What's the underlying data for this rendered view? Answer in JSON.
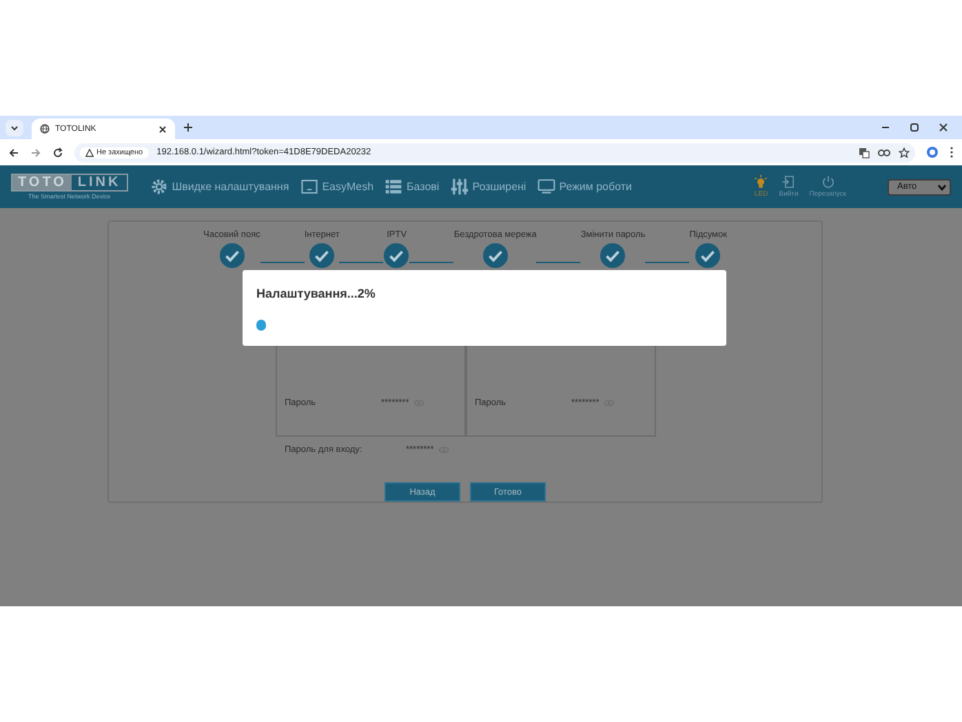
{
  "browser": {
    "tab": {
      "title": "TOTOLINK"
    },
    "security": "Не захищено",
    "url": "192.168.0.1/wizard.html?token=41D8E79DEDA20232"
  },
  "header": {
    "logo": "TOTO",
    "logo_box": "LINK",
    "tagline": "The Smartest Network Device",
    "nav": [
      {
        "kind": "gear",
        "label": "Швидке налаштування"
      },
      {
        "kind": "mesh",
        "label": "EasyMesh"
      },
      {
        "kind": "list",
        "label": "Базові"
      },
      {
        "kind": "sliders",
        "label": "Розширені"
      },
      {
        "kind": "monitor",
        "label": "Режим роботи"
      }
    ],
    "actions": [
      {
        "kind": "led",
        "label": "LED"
      },
      {
        "kind": "logout",
        "label": "Вийти"
      },
      {
        "kind": "power",
        "label": "Перезапуск"
      }
    ],
    "language": "Авто"
  },
  "steps": [
    {
      "label": "Часовий пояс",
      "done": true
    },
    {
      "label": "Інтернет",
      "done": true
    },
    {
      "label": "IPTV",
      "done": true
    },
    {
      "label": "Бездротова мережа",
      "done": true
    },
    {
      "label": "Змінити пароль",
      "done": true
    },
    {
      "label": "Підсумок",
      "done": true
    }
  ],
  "networks": [
    {
      "password_label": "Пароль",
      "password": "********"
    },
    {
      "password_label": "Пароль",
      "password": "********"
    }
  ],
  "login": {
    "label": "Пароль для входу:",
    "value": "********"
  },
  "buttons": [
    "Назад",
    "Готово"
  ],
  "dialog": {
    "title": "Налаштування...2%",
    "level": 0.02
  }
}
